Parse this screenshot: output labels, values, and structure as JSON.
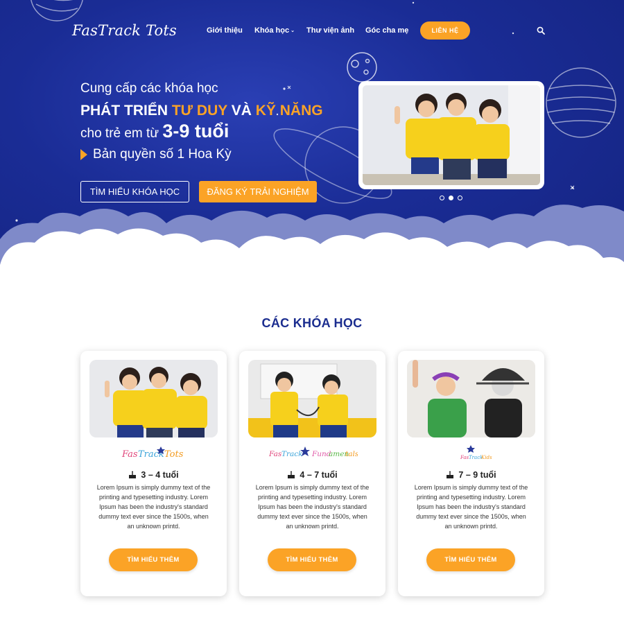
{
  "header": {
    "logo": "FasTrack Tots",
    "nav": [
      {
        "label": "Giới thiệu"
      },
      {
        "label": "Khóa học"
      },
      {
        "label": "Thư viện ảnh"
      },
      {
        "label": "Góc cha mẹ"
      }
    ],
    "contact_label": "LIÊN HỆ",
    "search_icon": "search-icon"
  },
  "hero": {
    "line1": "Cung cấp các khóa học",
    "line2_a": "PHÁT TRIỂN ",
    "line2_b": "TƯ DUY",
    "line2_c": " VÀ ",
    "line2_d": "KỸ NĂNG",
    "line3_a": "cho trẻ em từ ",
    "line3_b": "3-9 tuổi",
    "line4": "Bản quyền số 1 Hoa Kỳ",
    "btn_explore": "TÌM HIỂU KHÓA HỌC",
    "btn_register": "ĐĂNG KÝ TRẢI NGHIỆM",
    "slider_active_index": 1,
    "slider_count": 3
  },
  "courses": {
    "title": "CÁC KHÓA HỌC",
    "items": [
      {
        "logo": "FasTrack Tots",
        "age": "3 – 4 tuổi",
        "desc": "Lorem Ipsum is simply dummy text of the printing and typesetting industry. Lorem Ipsum has been the industry's standard dummy text ever since the 1500s, when an unknown printd.",
        "button": "TÌM HIỂU THÊM"
      },
      {
        "logo": "FasTrack Fundamentals",
        "age": "4 – 7 tuổi",
        "desc": "Lorem Ipsum is simply dummy text of the printing and typesetting industry. Lorem Ipsum has been the industry's standard dummy text ever since the 1500s, when an unknown printd.",
        "button": "TÌM HIỂU THÊM"
      },
      {
        "logo": "FasTrack Kids",
        "age": "7 – 9 tuổi",
        "desc": "Lorem Ipsum is simply dummy text of the printing and typesetting industry. Lorem Ipsum has been the industry's standard dummy text ever since the 1500s, when an unknown printd.",
        "button": "TÌM HIỂU THÊM"
      }
    ]
  },
  "colors": {
    "brand_blue": "#1a2c95",
    "accent_orange": "#fba326",
    "title_blue": "#1b2d8f"
  }
}
